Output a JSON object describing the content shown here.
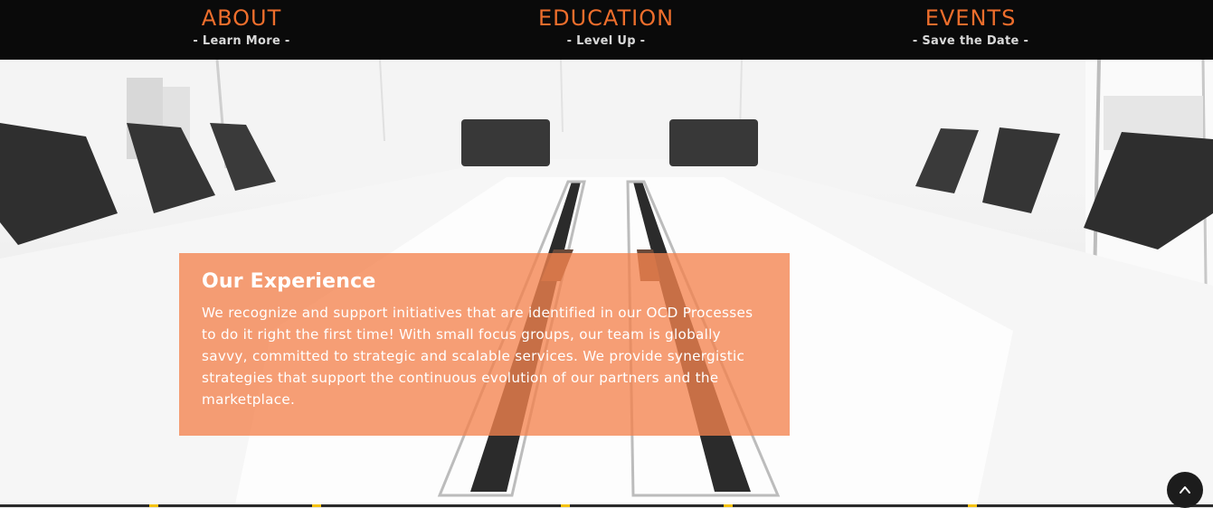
{
  "nav": {
    "items": [
      {
        "title": "ABOUT",
        "subtitle": "- Learn More -"
      },
      {
        "title": "EDUCATION",
        "subtitle": "- Level Up -"
      },
      {
        "title": "EVENTS",
        "subtitle": "- Save the Date -"
      }
    ]
  },
  "hero": {
    "heading": "Our Experience",
    "body": "We recognize and support initiatives that are identified in our OCD Processes to do it right the first time! With small focus groups, our team is globally savvy, committed to strategic and scalable services. We provide synergistic strategies that support the continuous evolution of our partners and the marketplace."
  },
  "colors": {
    "accent": "#ee6e2c",
    "nav_background": "#0a0a0a",
    "overlay": "#f4834e"
  },
  "icons": {
    "back_to_top": "chevron-up-icon"
  }
}
